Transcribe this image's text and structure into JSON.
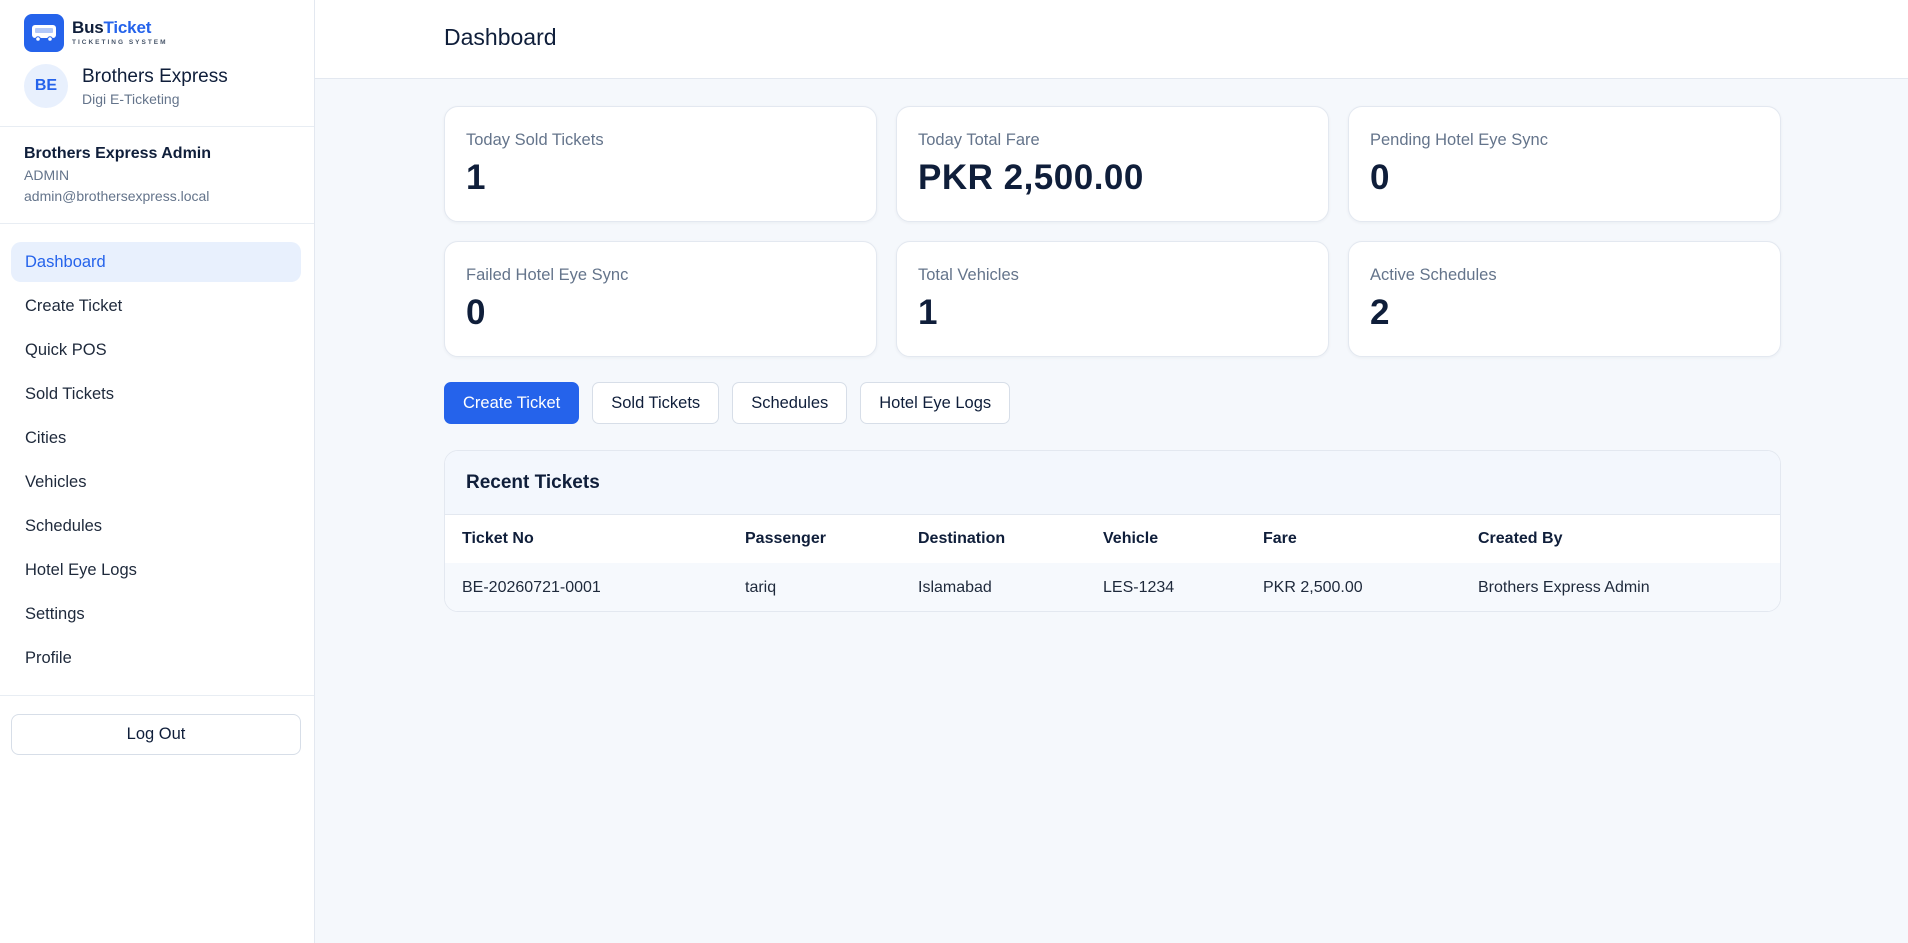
{
  "brand": {
    "name_part1": "Bus",
    "name_part2": "Ticket",
    "tagline": "TICKETING SYSTEM",
    "logo_icon": "bus-icon",
    "accent_color": "#2563eb"
  },
  "company": {
    "initials": "BE",
    "name": "Brothers Express",
    "subtitle": "Digi E-Ticketing"
  },
  "user": {
    "name": "Brothers Express Admin",
    "role": "ADMIN",
    "email": "admin@brothersexpress.local"
  },
  "sidebar": {
    "items": [
      {
        "label": "Dashboard",
        "active": true
      },
      {
        "label": "Create Ticket",
        "active": false
      },
      {
        "label": "Quick POS",
        "active": false
      },
      {
        "label": "Sold Tickets",
        "active": false
      },
      {
        "label": "Cities",
        "active": false
      },
      {
        "label": "Vehicles",
        "active": false
      },
      {
        "label": "Schedules",
        "active": false
      },
      {
        "label": "Hotel Eye Logs",
        "active": false
      },
      {
        "label": "Settings",
        "active": false
      },
      {
        "label": "Profile",
        "active": false
      }
    ],
    "logout_label": "Log Out"
  },
  "header": {
    "title": "Dashboard"
  },
  "stats": [
    {
      "label": "Today Sold Tickets",
      "value": "1"
    },
    {
      "label": "Today Total Fare",
      "value": "PKR 2,500.00"
    },
    {
      "label": "Pending Hotel Eye Sync",
      "value": "0"
    },
    {
      "label": "Failed Hotel Eye Sync",
      "value": "0"
    },
    {
      "label": "Total Vehicles",
      "value": "1"
    },
    {
      "label": "Active Schedules",
      "value": "2"
    }
  ],
  "actions": {
    "create_ticket": "Create Ticket",
    "sold_tickets": "Sold Tickets",
    "schedules": "Schedules",
    "hotel_eye_logs": "Hotel Eye Logs"
  },
  "recent_tickets": {
    "title": "Recent Tickets",
    "columns": [
      "Ticket No",
      "Passenger",
      "Destination",
      "Vehicle",
      "Fare",
      "Created By"
    ],
    "rows": [
      [
        "BE-20260721-0001",
        "tariq",
        "Islamabad",
        "LES-1234",
        "PKR 2,500.00",
        "Brothers Express Admin"
      ]
    ]
  }
}
